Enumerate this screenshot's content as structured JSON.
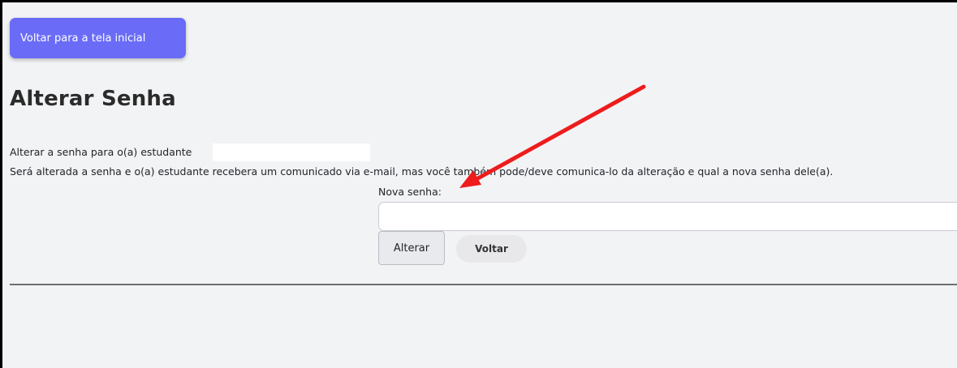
{
  "header": {
    "home_button_label": "Voltar para a tela inicial"
  },
  "page": {
    "title": "Alterar Senha",
    "description_line1": "Alterar a senha para o(a) estudante",
    "description_line2": "Será alterada a senha e o(a) estudante recebera um comunicado via e-mail, mas você também pode/deve comunica-lo da alteração e qual a nova senha dele(a)."
  },
  "form": {
    "new_password_label": "Nova senha:",
    "new_password_value": "",
    "submit_label": "Alterar",
    "back_label": "Voltar"
  },
  "annotation": {
    "arrow_color": "#ee1c1c",
    "arrow_icon": "red-arrow-icon"
  },
  "colors": {
    "primary": "#6a6cf7",
    "background": "#f2f3f5"
  }
}
